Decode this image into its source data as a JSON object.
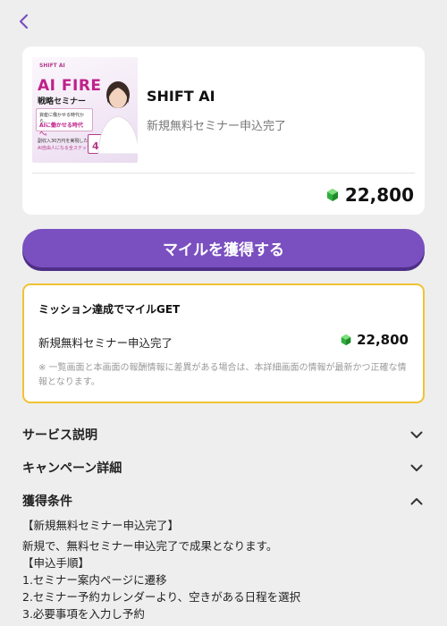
{
  "nav": {
    "back_icon": "chevron-left-icon"
  },
  "offer": {
    "title": "SHIFT AI",
    "subtitle": "新規無料セミナー申込完了",
    "miles": "22,800",
    "miles_icon": "green-gem-icon",
    "thumbnail": {
      "brand": "SHIFT AI",
      "headline": "AI FIRE",
      "subhead": "戦略セミナー",
      "box_line1": "資産に働かせる時代から、",
      "box_line2": "AIに働かせる時代へ。",
      "small_line1": "副収入30万円を実現した、",
      "small_line2": "AI自由人になる全ステップ",
      "stat": "4万人"
    }
  },
  "earn_button": {
    "label": "マイルを獲得する"
  },
  "mission": {
    "title": "ミッション達成でマイルGET",
    "row_label": "新規無料セミナー申込完了",
    "row_value": "22,800",
    "note": "※ 一覧画面と本画面の報酬情報に差異がある場合は、本詳細画面の情報が最新かつ正確な情報となります。"
  },
  "accordion": {
    "service": "サービス説明",
    "campaign": "キャンペーン詳細",
    "conditions": "獲得条件"
  },
  "conditions_details": {
    "heading": "【新規無料セミナー申込完了】",
    "description": "新規で、無料セミナー申込完了で成果となります。",
    "steps_heading": "【申込手順】",
    "step1": "1.セミナー案内ページに遷移",
    "step2": "2.セミナー予約カレンダーより、空きがある日程を選択",
    "step3": "3.必要事項を入力し予約"
  },
  "colors": {
    "accent": "#7a50c0",
    "mission_border": "#f1c232",
    "gem": "#3cc24a",
    "background": "#eeeeee"
  }
}
